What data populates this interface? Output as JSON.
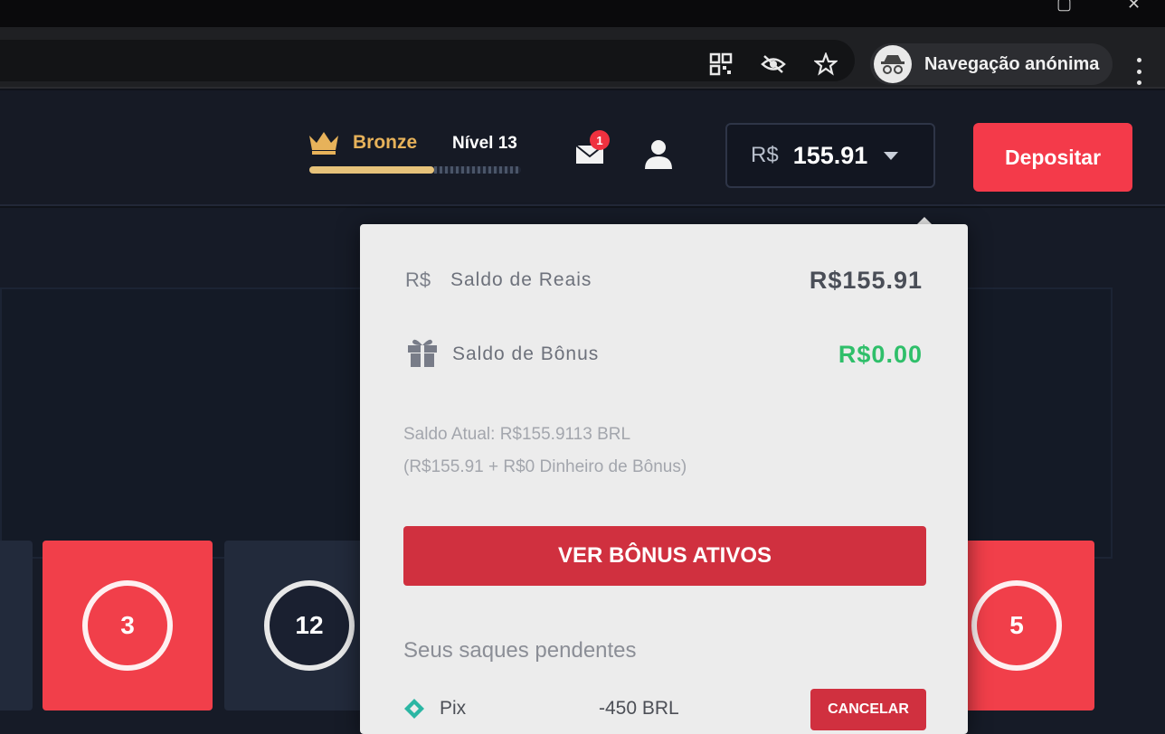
{
  "browser": {
    "incognito_label": "Navegação anónima"
  },
  "header": {
    "rank_name": "Bronze",
    "level_label": "Nível 13",
    "xp_progress": 0.59,
    "notification_count": "1",
    "balance_currency": "R$",
    "balance_amount": "155.91",
    "deposit_label": "Depositar"
  },
  "dropdown": {
    "real_currency_symbol": "R$",
    "real_label": "Saldo de Reais",
    "real_amount": "R$155.91",
    "bonus_label": "Saldo de Bônus",
    "bonus_amount": "R$0.00",
    "current_balance_line": "Saldo Atual: R$155.9113 BRL",
    "breakdown_line": "(R$155.91 + R$0 Dinheiro de Bônus)",
    "active_bonus_button": "VER BÔNUS ATIVOS",
    "pending_title": "Seus saques pendentes",
    "pending": [
      {
        "method": "Pix",
        "amount": "-450 BRL",
        "action": "CANCELAR"
      }
    ]
  },
  "tiles": [
    {
      "number": "3",
      "color": "red"
    },
    {
      "number": "12",
      "color": "dark"
    },
    {
      "number": "5",
      "color": "red"
    }
  ],
  "colors": {
    "accent_red": "#f43a4a",
    "bronze": "#e7b25a",
    "bonus_green": "#2fbf6a",
    "pix_teal": "#2bb6a3"
  }
}
